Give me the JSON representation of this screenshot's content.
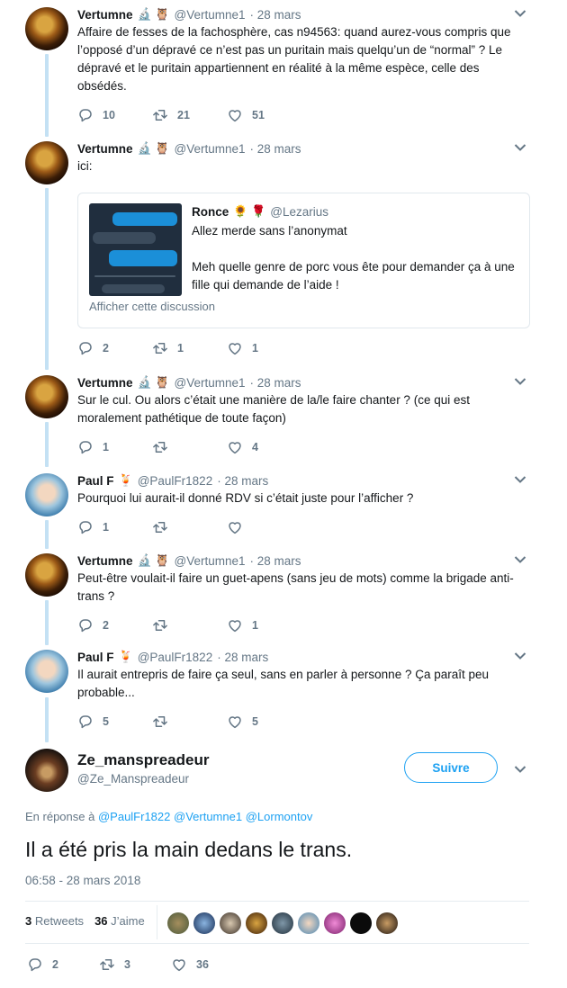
{
  "tweets": [
    {
      "name": "Vertumne",
      "emoji": "🔬 🦉",
      "handle": "@Vertumne1",
      "date": "· 28 mars",
      "text": "Affaire de fesses de la fachosphère, cas n94563: quand aurez-vous compris que l’opposé d’un dépravé ce n’est pas un puritain mais quelqu’un de “normal” ? Le dépravé et le puritain appartiennent en réalité à la même espèce, celle des obsédés.",
      "replies": "10",
      "retweets": "21",
      "likes": "51"
    },
    {
      "name": "Vertumne",
      "emoji": "🔬 🦉",
      "handle": "@Vertumne1",
      "date": "· 28 mars",
      "text": "ici:",
      "replies": "2",
      "retweets": "1",
      "likes": "1",
      "quote": {
        "name": "Ronce",
        "emoji": "🌻 🌹",
        "handle": "@Lezarius",
        "line1": "Allez merde sans l’anonymat",
        "line2": "Meh quelle genre de porc vous ête pour demander ça à une fille qui demande de l’aide !",
        "show": "Afficher cette discussion"
      }
    },
    {
      "name": "Vertumne",
      "emoji": "🔬 🦉",
      "handle": "@Vertumne1",
      "date": "· 28 mars",
      "text": "Sur le cul. Ou alors c’était une manière de la/le faire chanter ? (ce qui est moralement pathétique de toute façon)",
      "replies": "1",
      "retweets": "",
      "likes": "4"
    },
    {
      "name": "Paul F",
      "emoji": "🍹",
      "handle": "@PaulFr1822",
      "date": "· 28 mars",
      "text": "Pourquoi lui aurait-il donné RDV si c’était juste pour l’afficher ?",
      "replies": "1",
      "retweets": "",
      "likes": ""
    },
    {
      "name": "Vertumne",
      "emoji": "🔬 🦉",
      "handle": "@Vertumne1",
      "date": "· 28 mars",
      "text": "Peut-être voulait-il faire un guet-apens (sans jeu de mots) comme la brigade anti-trans ?",
      "replies": "2",
      "retweets": "",
      "likes": "1"
    },
    {
      "name": "Paul F",
      "emoji": "🍹",
      "handle": "@PaulFr1822",
      "date": "· 28 mars",
      "text": "Il aurait entrepris de faire ça seul, sans en parler à personne ? Ça paraît peu probable...",
      "replies": "5",
      "retweets": "",
      "likes": "5"
    }
  ],
  "main": {
    "name": "Ze_manspreadeur",
    "handle": "@Ze_Manspreadeur",
    "follow": "Suivre",
    "reply_prefix": "En réponse à",
    "reply_to": [
      "@PaulFr1822",
      "@Vertumne1",
      "@Lormontov"
    ],
    "text": "Il a été pris la main dedans le trans.",
    "timestamp": "06:58 - 28 mars 2018",
    "retweets_count": "3",
    "retweets_label": "Retweets",
    "likes_count": "36",
    "likes_label": "J’aime",
    "replies": "2",
    "retweets": "3",
    "likes": "36"
  },
  "colors": {
    "accent": "#1da1f2",
    "muted": "#657786",
    "thread": "#c4e1f4"
  },
  "icons": {
    "reply": "reply-icon",
    "retweet": "retweet-icon",
    "like": "heart-icon",
    "more": "chevron-down-icon"
  }
}
